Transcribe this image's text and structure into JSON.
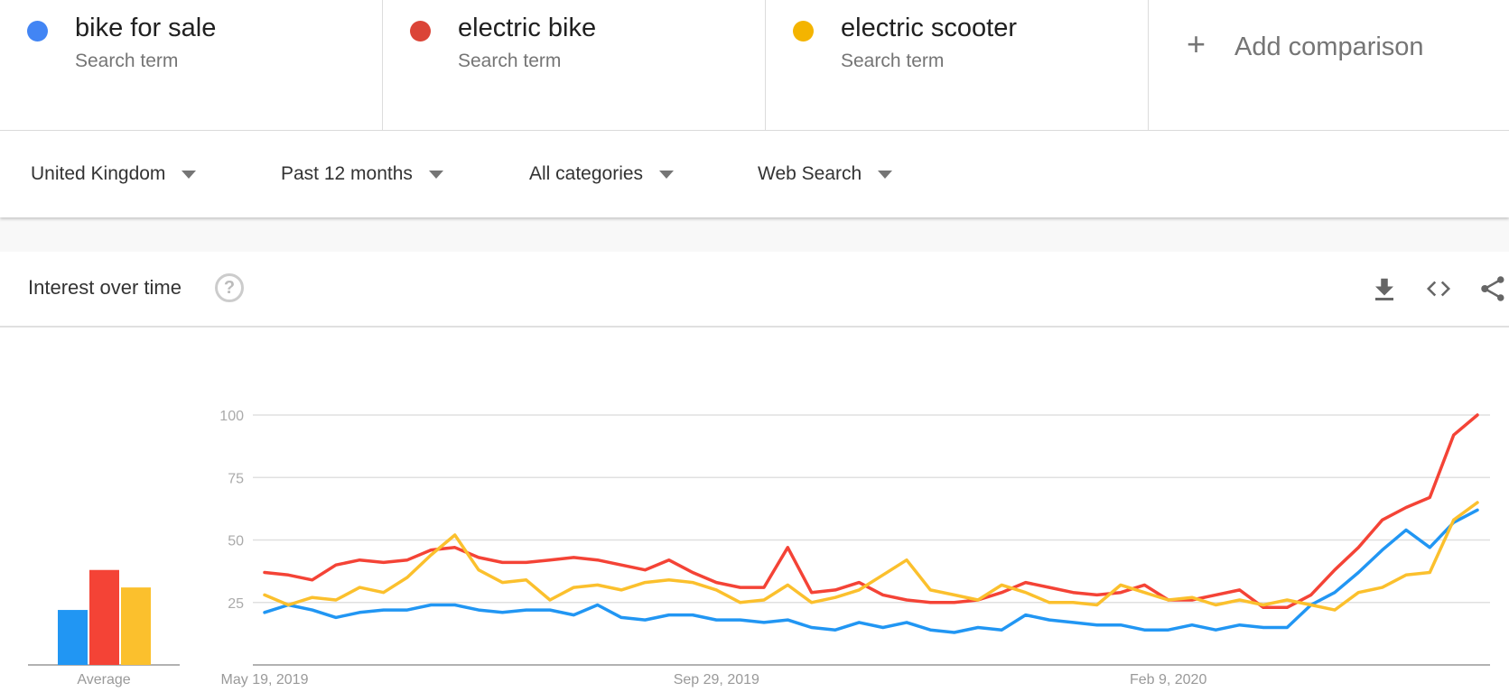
{
  "terms": [
    {
      "name": "bike for sale",
      "sub": "Search term",
      "color": "#4285f4"
    },
    {
      "name": "electric bike",
      "sub": "Search term",
      "color": "#db4437"
    },
    {
      "name": "electric scooter",
      "sub": "Search term",
      "color": "#f4b400"
    }
  ],
  "add_comparison": {
    "icon": "+",
    "label": "Add comparison"
  },
  "filters": [
    {
      "label": "United Kingdom"
    },
    {
      "label": "Past 12 months"
    },
    {
      "label": "All categories"
    },
    {
      "label": "Web Search"
    }
  ],
  "card": {
    "title": "Interest over time",
    "help_icon": "?",
    "actions": [
      "download-icon",
      "embed-icon",
      "share-icon"
    ]
  },
  "chart_data": {
    "type": "line",
    "title": "Interest over time",
    "xlabel": "",
    "ylabel": "",
    "ylim": [
      0,
      100
    ],
    "yticks": [
      25,
      50,
      75,
      100
    ],
    "grid": true,
    "x_tick_labels": [
      {
        "label": "May 19, 2019",
        "index": 0
      },
      {
        "label": "Sep 29, 2019",
        "index": 19
      },
      {
        "label": "Feb 9, 2020",
        "index": 38
      }
    ],
    "x_start": "May 19, 2019",
    "interval": "weekly",
    "series": [
      {
        "name": "bike for sale",
        "color": "#2196f3",
        "values": [
          21,
          24,
          22,
          19,
          21,
          22,
          22,
          24,
          24,
          22,
          21,
          22,
          22,
          20,
          24,
          19,
          18,
          20,
          20,
          18,
          18,
          17,
          18,
          15,
          14,
          17,
          15,
          17,
          14,
          13,
          15,
          14,
          20,
          18,
          17,
          16,
          16,
          14,
          14,
          16,
          14,
          16,
          15,
          15,
          24,
          29,
          37,
          46,
          54,
          47,
          57,
          62
        ]
      },
      {
        "name": "electric bike",
        "color": "#f44336",
        "values": [
          37,
          36,
          34,
          40,
          42,
          41,
          42,
          46,
          47,
          43,
          41,
          41,
          42,
          43,
          42,
          40,
          38,
          42,
          37,
          33,
          31,
          31,
          47,
          29,
          30,
          33,
          28,
          26,
          25,
          25,
          26,
          29,
          33,
          31,
          29,
          28,
          29,
          32,
          26,
          26,
          28,
          30,
          23,
          23,
          28,
          38,
          47,
          58,
          63,
          67,
          92,
          100
        ]
      },
      {
        "name": "electric scooter",
        "color": "#fbc02d",
        "values": [
          28,
          24,
          27,
          26,
          31,
          29,
          35,
          44,
          52,
          38,
          33,
          34,
          26,
          31,
          32,
          30,
          33,
          34,
          33,
          30,
          25,
          26,
          32,
          25,
          27,
          30,
          36,
          42,
          30,
          28,
          26,
          32,
          29,
          25,
          25,
          24,
          32,
          29,
          26,
          27,
          24,
          26,
          24,
          26,
          24,
          22,
          29,
          31,
          36,
          37,
          58,
          65
        ]
      }
    ],
    "average": {
      "label": "Average",
      "values": [
        {
          "name": "bike for sale",
          "value": 22,
          "color": "#2196f3"
        },
        {
          "name": "electric bike",
          "value": 38,
          "color": "#f44336"
        },
        {
          "name": "electric scooter",
          "value": 31,
          "color": "#fbc02d"
        }
      ]
    }
  }
}
